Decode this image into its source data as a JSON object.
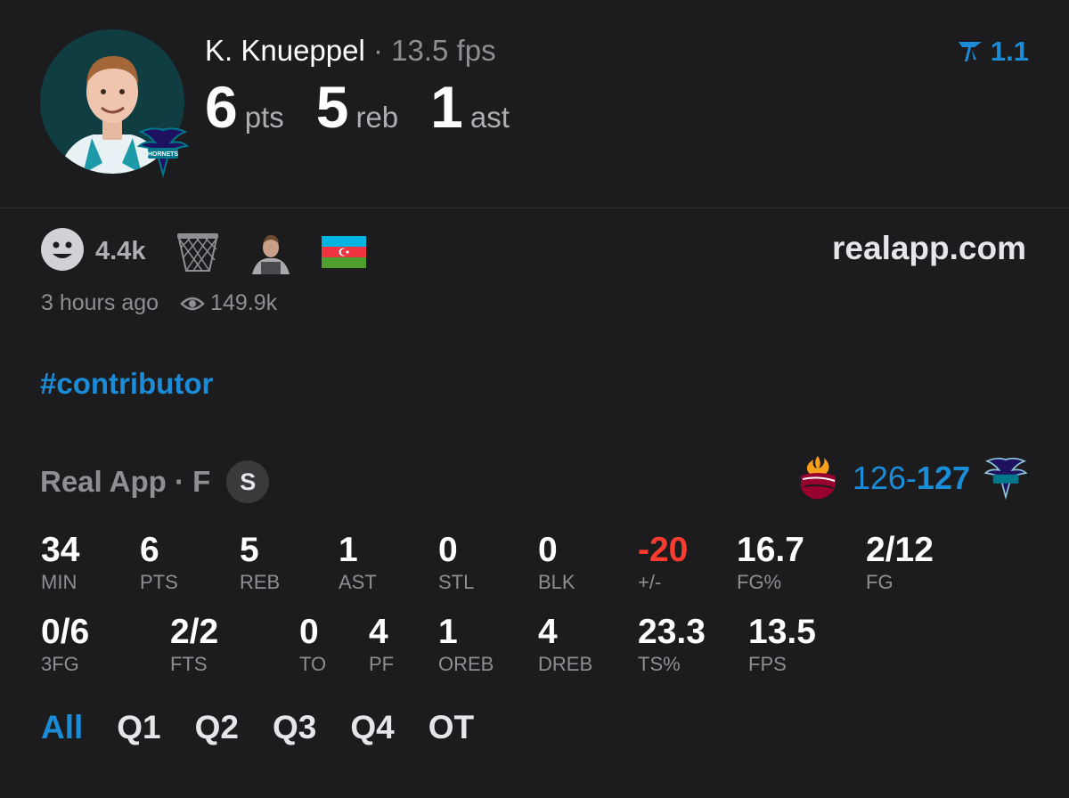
{
  "player": {
    "name": "K. Knueppel",
    "separator": "·",
    "fps": "13.5 fps",
    "team_badge_text": "HORNETS",
    "big_stats": [
      {
        "value": "6",
        "unit": "pts"
      },
      {
        "value": "5",
        "unit": "reb"
      },
      {
        "value": "1",
        "unit": "ast"
      }
    ]
  },
  "brand": {
    "version": "1.1",
    "icon": "real-app-logo-icon",
    "color": "#1a8cd8"
  },
  "reactions": {
    "count": "4.4k",
    "icons": [
      "smiley-icon",
      "basketball-net-icon",
      "player-thumbnail",
      "azerbaijan-flag-icon"
    ]
  },
  "site": "realapp.com",
  "meta": {
    "time": "3 hours ago",
    "views": "149.9k"
  },
  "hashtag": "#contributor",
  "game": {
    "source": "Real App · F",
    "badge": "S",
    "away_score": "126",
    "dash": "-",
    "home_score": "127",
    "away_team_icon": "miami-heat-logo-icon",
    "home_team_icon": "charlotte-hornets-logo-icon"
  },
  "stats_row1": [
    {
      "value": "34",
      "label": "MIN"
    },
    {
      "value": "6",
      "label": "PTS"
    },
    {
      "value": "5",
      "label": "REB"
    },
    {
      "value": "1",
      "label": "AST"
    },
    {
      "value": "0",
      "label": "STL"
    },
    {
      "value": "0",
      "label": "BLK"
    },
    {
      "value": "-20",
      "label": "+/-"
    },
    {
      "value": "16.7",
      "label": "FG%"
    },
    {
      "value": "2/12",
      "label": "FG"
    }
  ],
  "stats_row2": [
    {
      "value": "0/6",
      "label": "3FG"
    },
    {
      "value": "2/2",
      "label": "FTS"
    },
    {
      "value": "0",
      "label": "TO"
    },
    {
      "value": "4",
      "label": "PF"
    },
    {
      "value": "1",
      "label": "OREB"
    },
    {
      "value": "4",
      "label": "DREB"
    },
    {
      "value": "23.3",
      "label": "TS%"
    },
    {
      "value": "13.5",
      "label": "FPS"
    }
  ],
  "tabs": [
    "All",
    "Q1",
    "Q2",
    "Q3",
    "Q4",
    "OT"
  ],
  "colors": {
    "accent": "#1a8cd8",
    "negative": "#ff3b30",
    "background": "#1c1c1e"
  }
}
